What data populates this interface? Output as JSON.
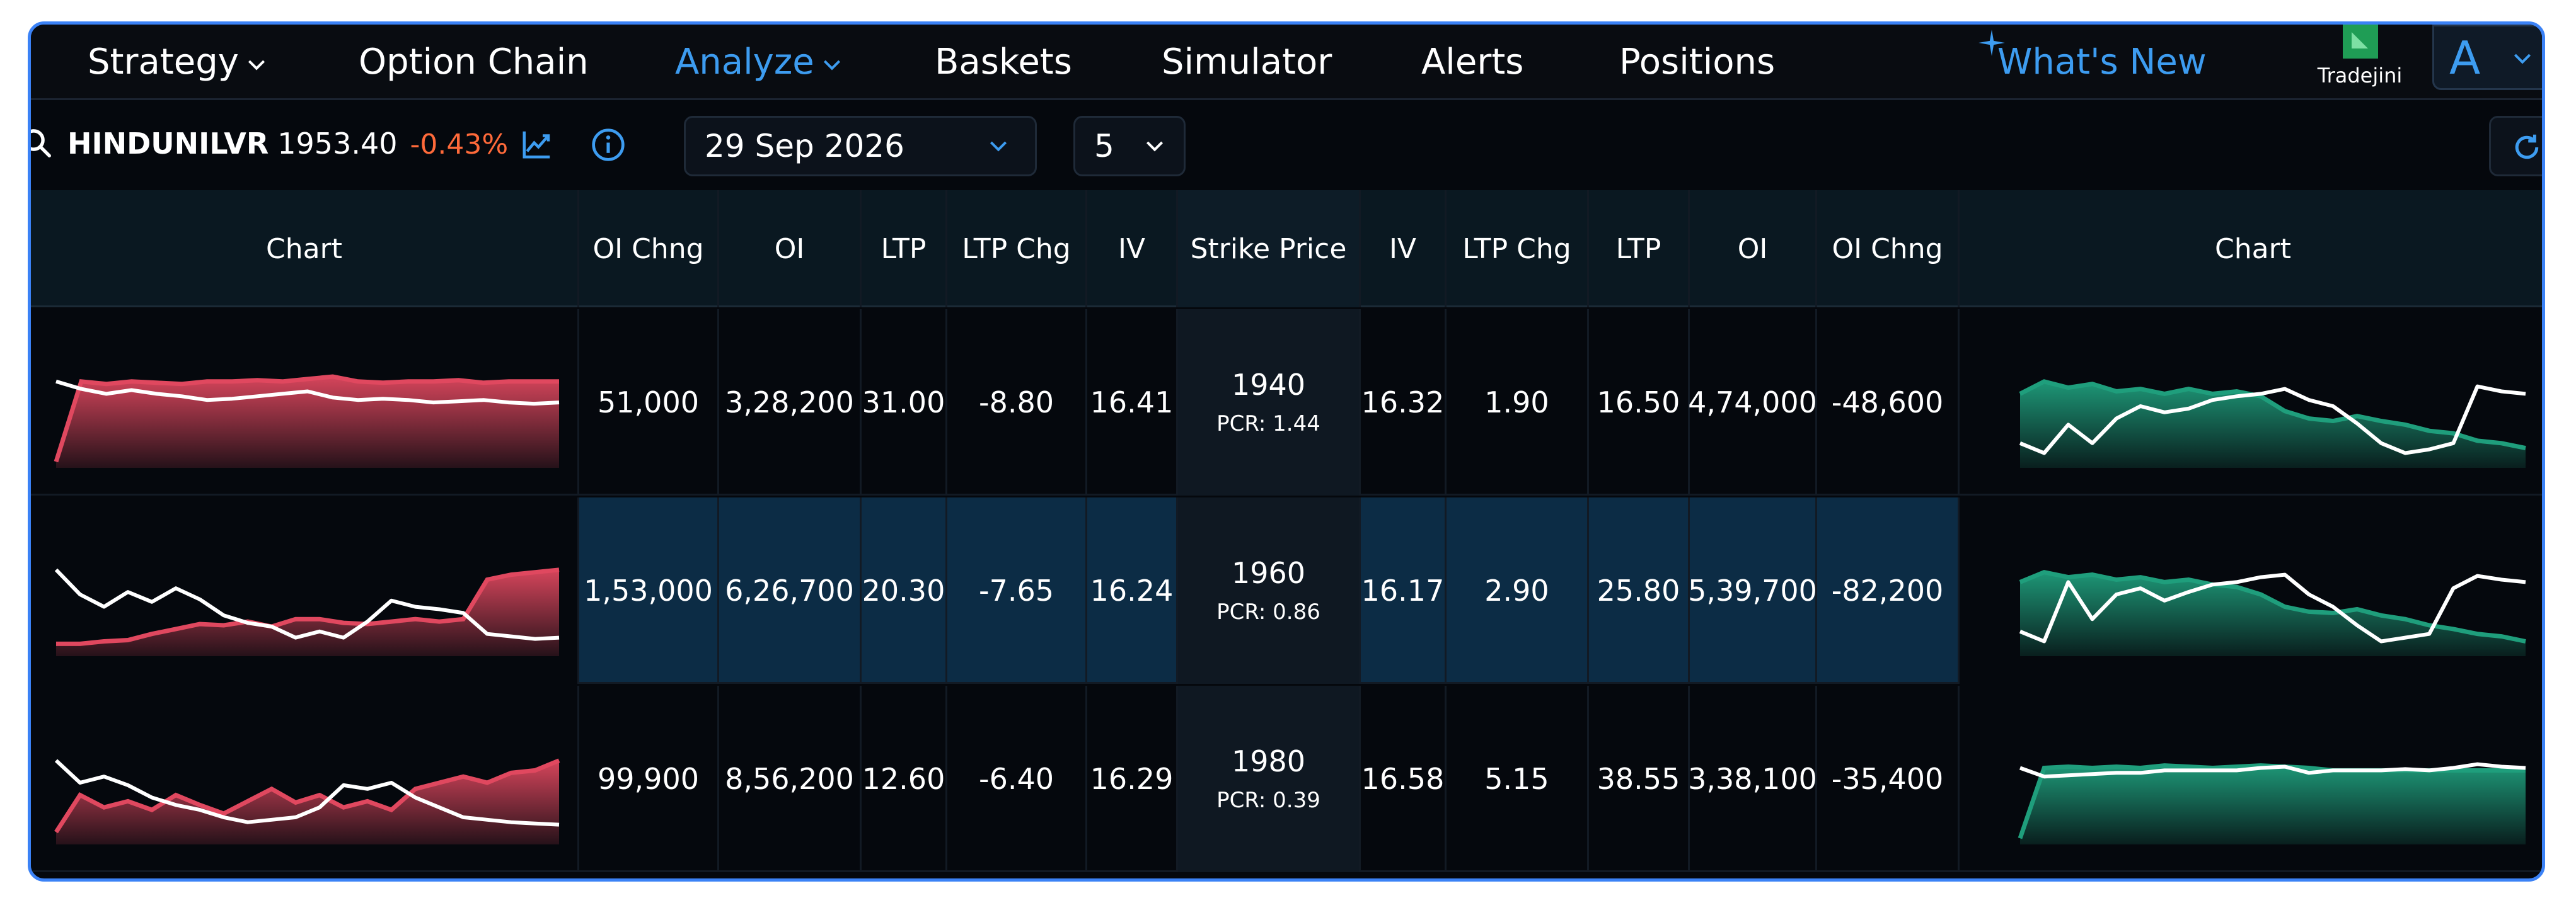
{
  "nav": {
    "items": [
      {
        "label": "Strategy",
        "dropdown": true,
        "active": false
      },
      {
        "label": "Option Chain",
        "dropdown": false,
        "active": false
      },
      {
        "label": "Analyze",
        "dropdown": true,
        "active": true
      },
      {
        "label": "Baskets",
        "dropdown": false,
        "active": false
      },
      {
        "label": "Simulator",
        "dropdown": false,
        "active": false
      },
      {
        "label": "Alerts",
        "dropdown": false,
        "active": false
      },
      {
        "label": "Positions",
        "dropdown": false,
        "active": false
      }
    ],
    "whats_new": "What's New",
    "broker_name": "Tradejini",
    "account_initial": "A"
  },
  "toolbar": {
    "symbol": "HINDUNILVR",
    "price": "1953.40",
    "change_pct": "-0.43%",
    "expiry": "29 Sep 2026",
    "strike_count": "5"
  },
  "table": {
    "headers": [
      "Chart",
      "OI Chng",
      "OI",
      "LTP",
      "LTP Chg",
      "IV",
      "Strike Price",
      "IV",
      "LTP Chg",
      "LTP",
      "OI",
      "OI Chng",
      "Chart"
    ],
    "rows": [
      {
        "strike": "1940",
        "pcr": "PCR: 1.44",
        "atm": false,
        "call": {
          "oi_chng": "51,000",
          "oi": "3,28,200",
          "ltp": "31.00",
          "ltp_chg": "-8.80",
          "iv": "16.41"
        },
        "put": {
          "iv": "16.32",
          "ltp_chg": "1.90",
          "ltp": "16.50",
          "oi": "4,74,000",
          "oi_chng": "-48,600"
        }
      },
      {
        "strike": "1960",
        "pcr": "PCR: 0.86",
        "atm": true,
        "call": {
          "oi_chng": "1,53,000",
          "oi": "6,26,700",
          "ltp": "20.30",
          "ltp_chg": "-7.65",
          "iv": "16.24"
        },
        "put": {
          "iv": "16.17",
          "ltp_chg": "2.90",
          "ltp": "25.80",
          "oi": "5,39,700",
          "oi_chng": "-82,200"
        }
      },
      {
        "strike": "1980",
        "pcr": "PCR: 0.39",
        "atm": false,
        "call": {
          "oi_chng": "99,900",
          "oi": "8,56,200",
          "ltp": "12.60",
          "ltp_chg": "-6.40",
          "iv": "16.29"
        },
        "put": {
          "iv": "16.58",
          "ltp_chg": "5.15",
          "ltp": "38.55",
          "oi": "3,38,100",
          "oi_chng": "-35,400"
        }
      }
    ]
  },
  "colors": {
    "accent": "#3d9cf0",
    "positive": "#76a33a",
    "negative": "#ff5a26",
    "call_chart": "#e0485f",
    "put_chart": "#1f9e7c",
    "price_line": "#ffffff"
  },
  "sparklines": {
    "call": [
      {
        "oi": [
          0.05,
          0.7,
          0.68,
          0.7,
          0.69,
          0.68,
          0.7,
          0.7,
          0.71,
          0.7,
          0.72,
          0.74,
          0.7,
          0.69,
          0.7,
          0.7,
          0.71,
          0.69,
          0.7,
          0.7,
          0.7
        ],
        "price": [
          0.7,
          0.64,
          0.6,
          0.63,
          0.6,
          0.58,
          0.55,
          0.56,
          0.58,
          0.6,
          0.62,
          0.57,
          0.55,
          0.56,
          0.55,
          0.53,
          0.54,
          0.55,
          0.53,
          0.52,
          0.53
        ]
      },
      {
        "oi": [
          0.1,
          0.1,
          0.12,
          0.13,
          0.18,
          0.22,
          0.26,
          0.25,
          0.28,
          0.24,
          0.3,
          0.3,
          0.27,
          0.26,
          0.28,
          0.3,
          0.28,
          0.3,
          0.62,
          0.66,
          0.68,
          0.7
        ],
        "price": [
          0.7,
          0.5,
          0.4,
          0.52,
          0.44,
          0.55,
          0.46,
          0.33,
          0.27,
          0.24,
          0.15,
          0.2,
          0.15,
          0.28,
          0.45,
          0.4,
          0.38,
          0.35,
          0.18,
          0.16,
          0.14,
          0.15
        ]
      },
      {
        "oi": [
          0.1,
          0.4,
          0.3,
          0.35,
          0.28,
          0.4,
          0.32,
          0.25,
          0.35,
          0.45,
          0.34,
          0.4,
          0.3,
          0.35,
          0.28,
          0.45,
          0.5,
          0.55,
          0.5,
          0.58,
          0.6,
          0.68
        ],
        "price": [
          0.68,
          0.5,
          0.55,
          0.48,
          0.38,
          0.32,
          0.28,
          0.22,
          0.18,
          0.2,
          0.22,
          0.3,
          0.48,
          0.45,
          0.5,
          0.38,
          0.3,
          0.22,
          0.2,
          0.18,
          0.17,
          0.16
        ]
      }
    ],
    "put": [
      {
        "oi": [
          0.6,
          0.7,
          0.65,
          0.68,
          0.62,
          0.64,
          0.6,
          0.64,
          0.6,
          0.62,
          0.58,
          0.46,
          0.4,
          0.38,
          0.42,
          0.38,
          0.35,
          0.3,
          0.28,
          0.22,
          0.2,
          0.16
        ],
        "price": [
          0.2,
          0.12,
          0.35,
          0.2,
          0.4,
          0.5,
          0.45,
          0.48,
          0.55,
          0.58,
          0.6,
          0.64,
          0.55,
          0.5,
          0.36,
          0.2,
          0.12,
          0.15,
          0.2,
          0.66,
          0.62,
          0.6
        ]
      },
      {
        "oi": [
          0.6,
          0.68,
          0.64,
          0.66,
          0.62,
          0.64,
          0.6,
          0.62,
          0.58,
          0.56,
          0.5,
          0.4,
          0.36,
          0.35,
          0.38,
          0.33,
          0.3,
          0.25,
          0.22,
          0.18,
          0.16,
          0.12
        ],
        "price": [
          0.2,
          0.12,
          0.6,
          0.3,
          0.5,
          0.55,
          0.45,
          0.52,
          0.58,
          0.6,
          0.64,
          0.66,
          0.5,
          0.4,
          0.25,
          0.12,
          0.15,
          0.18,
          0.55,
          0.65,
          0.62,
          0.6
        ]
      },
      {
        "oi": [
          0.05,
          0.62,
          0.63,
          0.62,
          0.63,
          0.62,
          0.64,
          0.63,
          0.62,
          0.63,
          0.64,
          0.63,
          0.62,
          0.6,
          0.6,
          0.6,
          0.6,
          0.6,
          0.6,
          0.6,
          0.6,
          0.6
        ],
        "price": [
          0.62,
          0.55,
          0.56,
          0.57,
          0.58,
          0.58,
          0.6,
          0.6,
          0.6,
          0.6,
          0.62,
          0.63,
          0.58,
          0.6,
          0.6,
          0.6,
          0.61,
          0.6,
          0.62,
          0.65,
          0.63,
          0.62
        ]
      }
    ]
  }
}
